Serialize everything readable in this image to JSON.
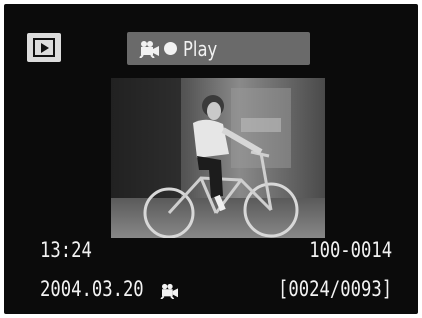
{
  "header": {
    "mode_icon": "playback-icon",
    "title_icons": [
      "movie-camera-icon",
      "record-dot-icon"
    ],
    "title": "Play"
  },
  "image": {
    "description_icon": "photo-thumbnail"
  },
  "info": {
    "time": "13:24",
    "file_number": "100-0014",
    "date": "2004.03.20",
    "date_icon": "movie-camera-icon",
    "frame_counter": "[0024/0093]"
  },
  "colors": {
    "screen_bg": "#0b0b0b",
    "title_bar_bg": "#6a6a6a",
    "text": "#f3f3f3",
    "badge_bg": "#dcdcdc"
  }
}
